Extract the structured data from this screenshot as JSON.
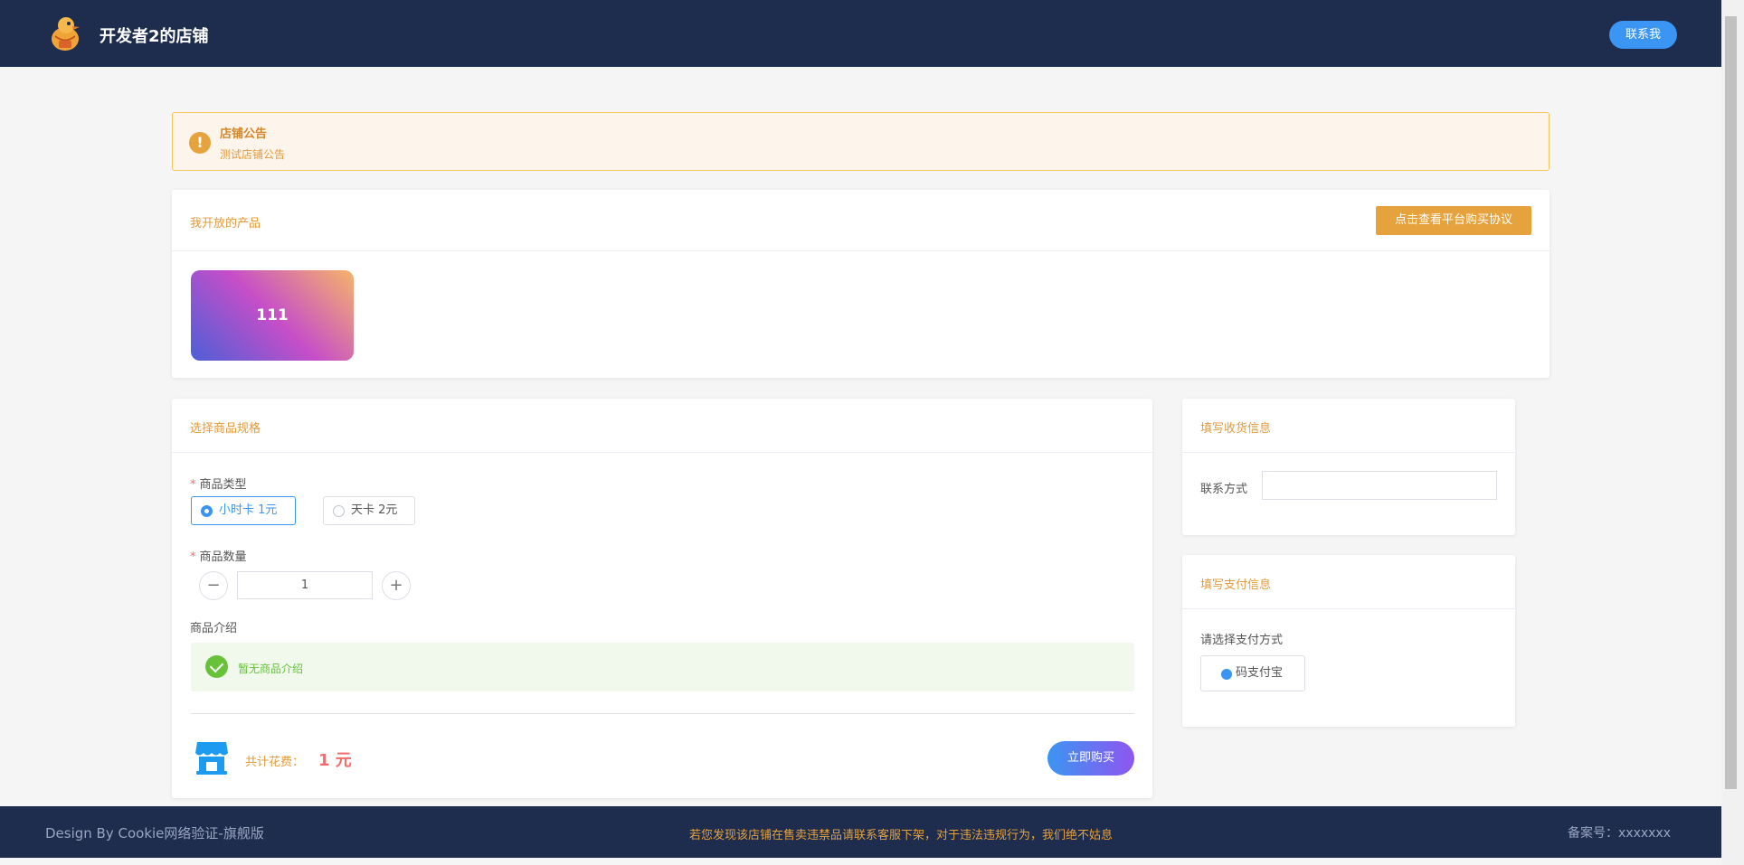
{
  "header": {
    "shop_name": "开发者2的店铺",
    "contact_label": "联系我"
  },
  "notice": {
    "title": "店铺公告",
    "text": "测试店铺公告",
    "icon": "exclamation-icon"
  },
  "products": {
    "title": "我开放的产品",
    "agreement_label": "点击查看平台购买协议",
    "items": [
      {
        "name": "111"
      }
    ]
  },
  "spec": {
    "title": "选择商品规格",
    "type_label": "商品类型",
    "options": [
      {
        "label": "小时卡 1元",
        "selected": true
      },
      {
        "label": "天卡 2元",
        "selected": false
      }
    ],
    "quantity_label": "商品数量",
    "quantity": "1",
    "minus": "−",
    "plus": "+",
    "desc_label": "商品介绍",
    "desc_text": "暂无商品介绍",
    "total_label": "共计花费：",
    "total_value": "1 元",
    "buy_label": "立即购买"
  },
  "shipping": {
    "title": "填写收货信息",
    "contact_label": "联系方式",
    "contact_value": ""
  },
  "payment": {
    "title": "填写支付信息",
    "choose_label": "请选择支付方式",
    "option_label": "码支付宝"
  },
  "footer": {
    "left": "Design By Cookie网络验证-旗舰版",
    "center": "若您发现该店铺在售卖违禁品请联系客服下架，对于违法违规行为，我们绝不姑息",
    "right": "备案号：xxxxxxx"
  },
  "colors": {
    "header_bg": "#1e2c4e",
    "accent": "#e6a23c",
    "primary": "#3b95f2",
    "danger": "#f56c6c",
    "success": "#67c23a"
  }
}
